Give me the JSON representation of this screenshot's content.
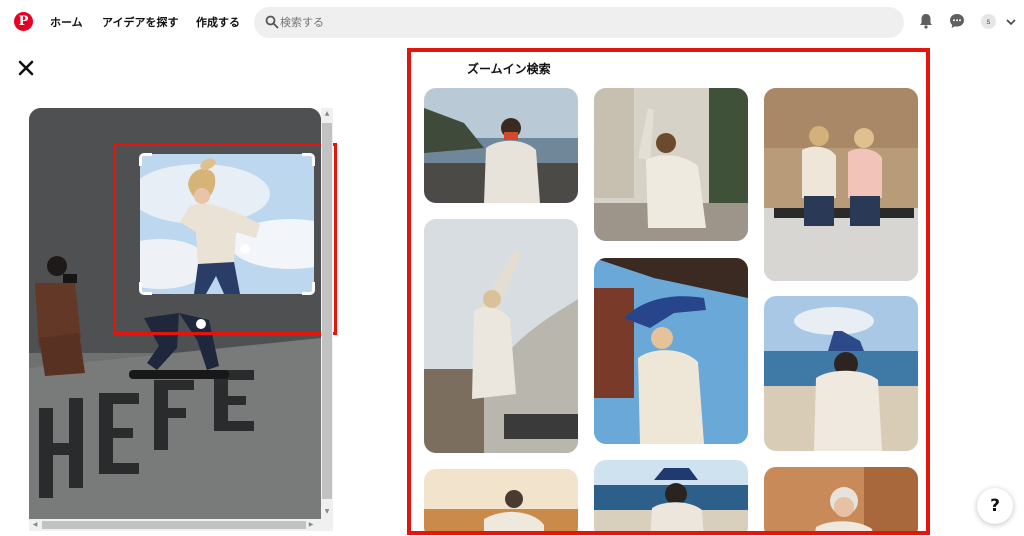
{
  "header": {
    "logo": "P",
    "nav": [
      {
        "label": "ホーム"
      },
      {
        "label": "アイデアを探す"
      },
      {
        "label": "作成する"
      }
    ],
    "search": {
      "placeholder": "検索する"
    },
    "avatar_initial": "s"
  },
  "results": {
    "title": "ズームイン検索"
  },
  "help": {
    "label": "?"
  },
  "colors": {
    "brand": "#e60023",
    "highlight": "#e4150f",
    "search_bg": "#efefef"
  }
}
